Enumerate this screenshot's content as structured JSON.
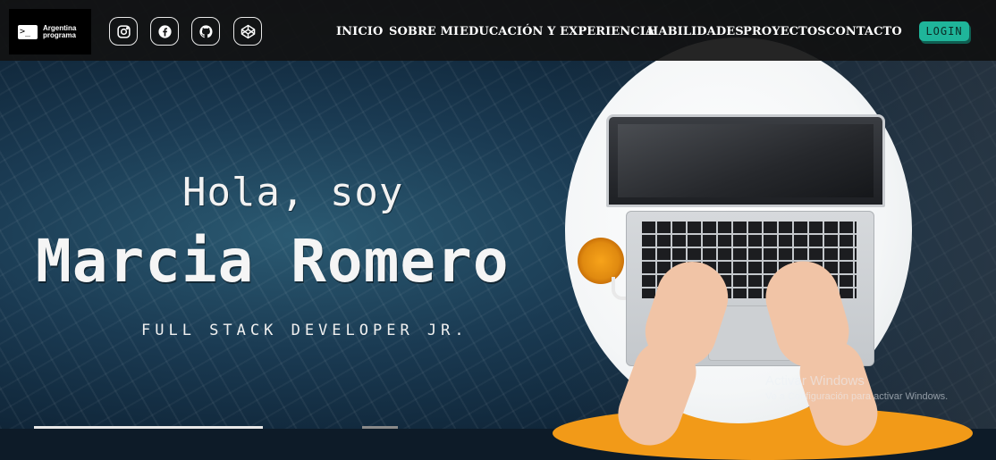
{
  "logo": {
    "mark": ">_",
    "line1": "Argentina",
    "line2": "programa"
  },
  "social": [
    {
      "name": "instagram-icon"
    },
    {
      "name": "facebook-icon"
    },
    {
      "name": "github-icon"
    },
    {
      "name": "codepen-icon"
    }
  ],
  "nav": {
    "inicio": "INICIO",
    "sobre_mi": "SOBRE MI",
    "educacion": "EDUCACIÓN Y EXPERIENCIA",
    "habilidades": "HABILIDADES",
    "proyectos": "PROYECTOS",
    "contacto": "CONTACTO",
    "login": "LOGIN"
  },
  "hero": {
    "greeting": "Hola, soy",
    "name": "Marcia Romero",
    "role": "FULL STACK DEVELOPER JR."
  },
  "watermark": {
    "title": "Activar Windows",
    "subtitle": "Ve a Configuración para activar Windows."
  },
  "colors": {
    "accent": "#1fb59a",
    "navbar": "#121212"
  }
}
